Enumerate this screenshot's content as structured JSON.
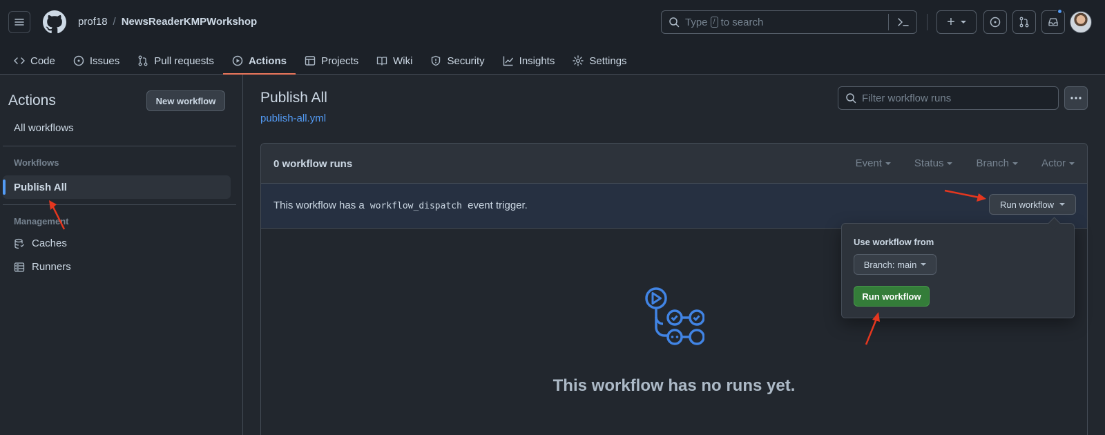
{
  "header": {
    "owner": "prof18",
    "separator": "/",
    "repo": "NewsReaderKMPWorkshop",
    "search_prefix": "Type",
    "search_key": "/",
    "search_suffix": "to search",
    "new_button": "+"
  },
  "tabs": [
    {
      "label": "Code",
      "icon": "code-icon"
    },
    {
      "label": "Issues",
      "icon": "issue-icon"
    },
    {
      "label": "Pull requests",
      "icon": "pull-request-icon"
    },
    {
      "label": "Actions",
      "icon": "play-icon",
      "active": true
    },
    {
      "label": "Projects",
      "icon": "table-icon"
    },
    {
      "label": "Wiki",
      "icon": "book-icon"
    },
    {
      "label": "Security",
      "icon": "shield-icon"
    },
    {
      "label": "Insights",
      "icon": "graph-icon"
    },
    {
      "label": "Settings",
      "icon": "gear-icon"
    }
  ],
  "sidebar": {
    "title": "Actions",
    "new_workflow": "New workflow",
    "all_workflows": "All workflows",
    "workflows_heading": "Workflows",
    "selected_workflow": "Publish All",
    "management_heading": "Management",
    "management_items": [
      "Caches",
      "Runners"
    ]
  },
  "main": {
    "title": "Publish All",
    "file": "publish-all.yml",
    "filter_placeholder": "Filter workflow runs",
    "runs_count": "0 workflow runs",
    "filters": [
      "Event",
      "Status",
      "Branch",
      "Actor"
    ],
    "dispatch_prefix": "This workflow has a",
    "dispatch_code": "workflow_dispatch",
    "dispatch_suffix": "event trigger.",
    "run_workflow_button": "Run workflow",
    "empty_message": "This workflow has no runs yet."
  },
  "dropdown": {
    "label": "Use workflow from",
    "branch_button": "Branch: main",
    "run_button": "Run workflow"
  },
  "colors": {
    "background": "#22272e",
    "header": "#1c2128",
    "accent_blue": "#539bf5",
    "active_tab_underline": "#ec775c",
    "run_button_green": "#347d39",
    "annotation_arrow": "#e5371f"
  }
}
